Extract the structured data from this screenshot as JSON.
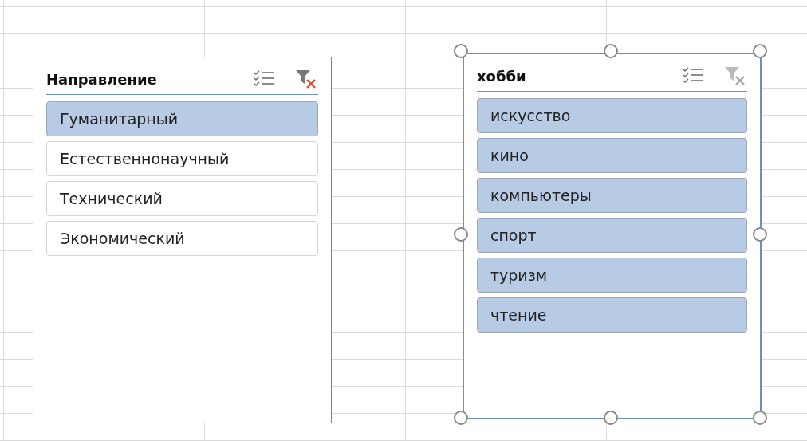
{
  "slicers": [
    {
      "title": "Направление",
      "selected": false,
      "filtered": true,
      "items": [
        {
          "label": "Гуманитарный",
          "selected": true
        },
        {
          "label": "Естественнонаучный",
          "selected": false
        },
        {
          "label": "Технический",
          "selected": false
        },
        {
          "label": "Экономический",
          "selected": false
        }
      ]
    },
    {
      "title": "хобби",
      "selected": true,
      "filtered": false,
      "items": [
        {
          "label": "искусство",
          "selected": true
        },
        {
          "label": "кино",
          "selected": true
        },
        {
          "label": "компьютеры",
          "selected": true
        },
        {
          "label": "спорт",
          "selected": true
        },
        {
          "label": "туризм",
          "selected": true
        },
        {
          "label": "чтение",
          "selected": true
        }
      ]
    }
  ]
}
